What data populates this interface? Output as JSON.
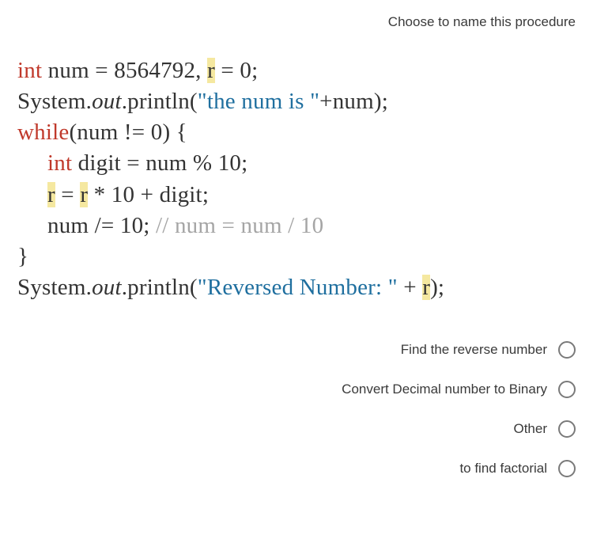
{
  "header": {
    "title": "Choose to name this procedure"
  },
  "code": {
    "l1": {
      "kw_int_1": "int",
      "t1": " num = 8564792, ",
      "hl_r": "r",
      "t2": " = 0;"
    },
    "l2": {
      "t1": "System.",
      "out": "out",
      "t2": ".println(",
      "str": "\"the num is \"",
      "t3": "+num);"
    },
    "l3": {
      "kw_while": "while",
      "t1": "(num != 0) {"
    },
    "l4": {
      "kw_int": "int",
      "t1": " digit = num % 10;"
    },
    "l5": {
      "hl_r1": "r",
      "t1": " = ",
      "hl_r2": "r",
      "t2": " * 10 + digit;"
    },
    "l6": {
      "t1": "num /= 10; ",
      "comment": "// num = num / 10"
    },
    "l7": {
      "t1": "}"
    },
    "l8": {
      "t1": "System.",
      "out": "out",
      "t2": ".println(",
      "str": "\"Reversed Number: \"",
      "t3": " + ",
      "hl_r": "r",
      "t4": ");"
    }
  },
  "options": {
    "items": [
      {
        "label": "Find the reverse number"
      },
      {
        "label": "Convert Decimal number to Binary"
      },
      {
        "label": "Other"
      },
      {
        "label": "to find factorial"
      }
    ]
  }
}
